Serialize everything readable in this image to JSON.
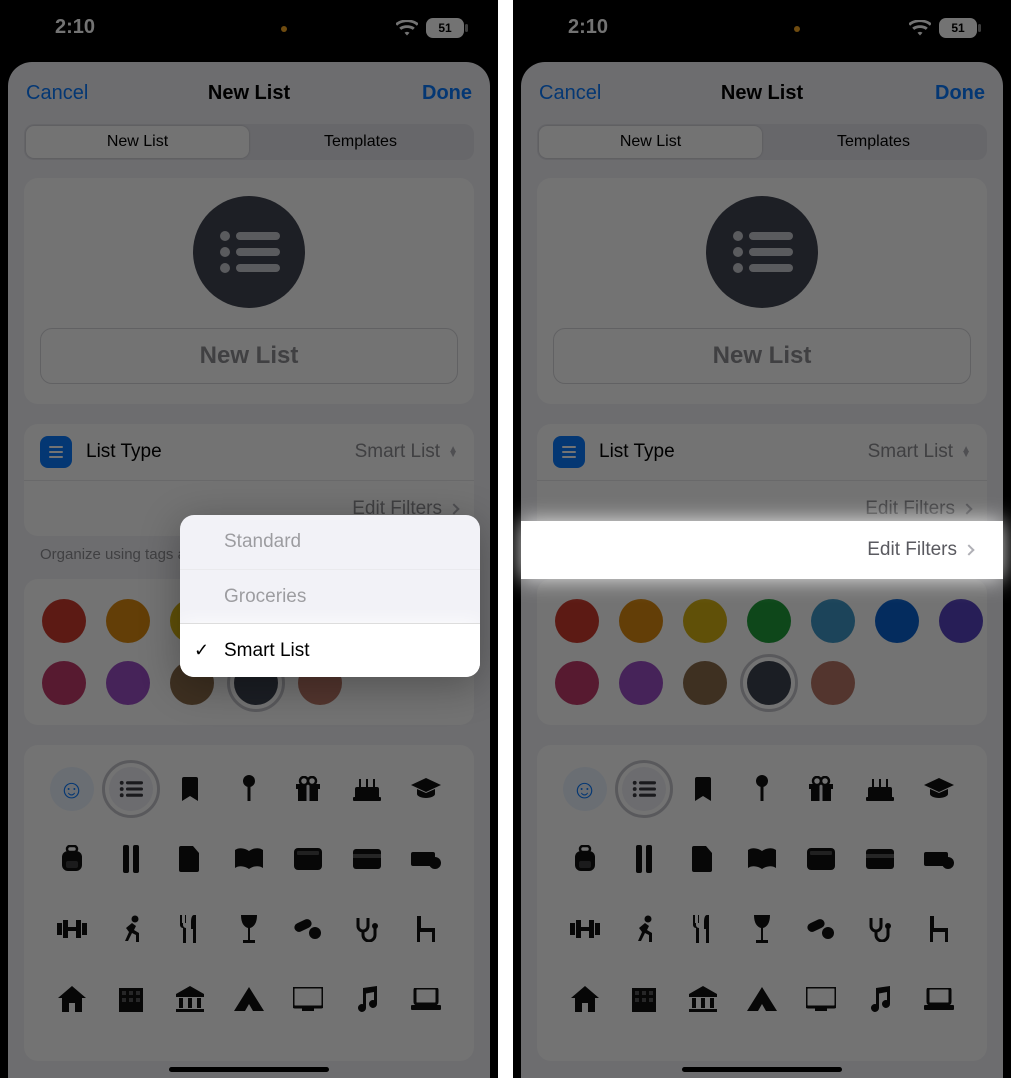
{
  "status": {
    "time": "2:10",
    "battery": "51"
  },
  "nav": {
    "cancel": "Cancel",
    "title": "New List",
    "done": "Done"
  },
  "segmented": {
    "new_list": "New List",
    "templates": "Templates"
  },
  "hero": {
    "placeholder": "New List"
  },
  "list_type": {
    "label": "List Type",
    "value": "Smart List"
  },
  "edit_filters": "Edit Filters",
  "hint": "Organize using tags and other filters.",
  "menu": {
    "standard": "Standard",
    "groceries": "Groceries",
    "smart": "Smart List"
  },
  "colors": [
    "#cc3b2e",
    "#dc8b10",
    "#d4b213",
    "#1f9e3a",
    "#3e98c7",
    "#0a62d0",
    "#5844c0",
    "#c23a6b",
    "#9b4fc6",
    "#8a6a4a",
    "#3d4350",
    "#b87766"
  ],
  "icons": [
    [
      "smile",
      "list",
      "bookmark",
      "pin",
      "gift",
      "cake",
      "grad"
    ],
    [
      "backpack",
      "ruler",
      "doc",
      "book",
      "tray",
      "card",
      "money"
    ],
    [
      "dumbbell",
      "run",
      "fork",
      "wine",
      "pills",
      "steth",
      "chair"
    ],
    [
      "house",
      "building",
      "bank",
      "tent",
      "tv",
      "music",
      "laptop"
    ]
  ]
}
